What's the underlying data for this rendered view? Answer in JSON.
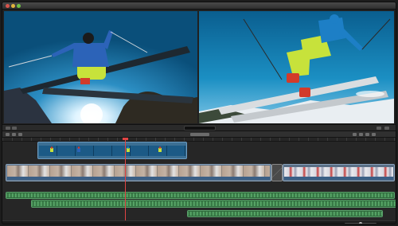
{
  "window": {
    "title": ""
  },
  "viewers": {
    "left": {
      "name": "event-viewer"
    },
    "right": {
      "name": "project-viewer"
    }
  },
  "viewer_bar": {
    "timecode": ""
  },
  "timeline": {
    "connected_clip_label": "",
    "primary_clip_label": "",
    "secondary_clip_label": "",
    "audio_labels": [
      "",
      "",
      ""
    ]
  },
  "colors": {
    "sky_blue": "#0b5d86",
    "skier_jacket_left": "#2c63b8",
    "skier_pants": "#c7e23b",
    "playhead": "#e04444",
    "audio_green": "#2f6a3c",
    "clip_blue": "#5a6f86"
  },
  "icons": [
    "close-icon",
    "minimize-icon",
    "maximize-icon",
    "play-icon",
    "blade-icon",
    "select-icon",
    "zoom-icon"
  ]
}
